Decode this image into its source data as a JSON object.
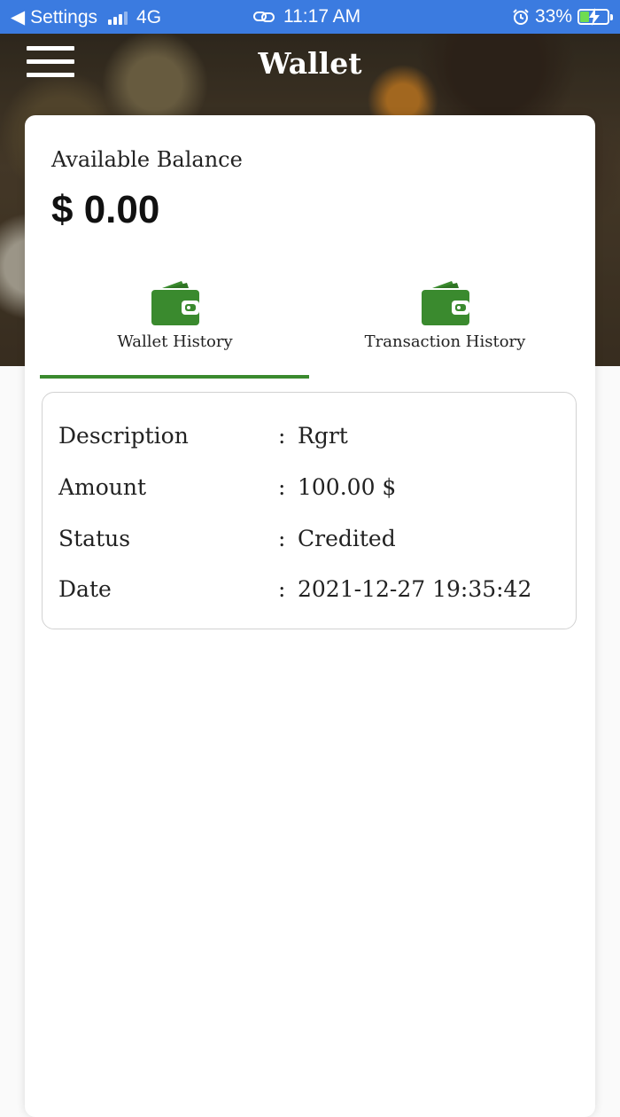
{
  "status_bar": {
    "back_app": "Settings",
    "network": "4G",
    "time": "11:17 AM",
    "battery": "33%",
    "battery_level": 0.33
  },
  "header": {
    "title": "Wallet"
  },
  "balance": {
    "label": "Available Balance",
    "value": "$ 0.00"
  },
  "tabs": [
    {
      "label": "Wallet History",
      "icon": "wallet-icon",
      "active": true
    },
    {
      "label": "Transaction History",
      "icon": "wallet-icon",
      "active": false
    }
  ],
  "history": {
    "separator": ":",
    "rows": [
      {
        "key": "Description",
        "value": "Rgrt"
      },
      {
        "key": "Amount",
        "value": "100.00 $"
      },
      {
        "key": "Status",
        "value": "Credited"
      },
      {
        "key": "Date",
        "value": "2021-12-27 19:35:42"
      }
    ]
  },
  "colors": {
    "status_bar": "#3b7be0",
    "accent_green": "#3a8a2e",
    "battery_fill": "#6fdc52"
  }
}
